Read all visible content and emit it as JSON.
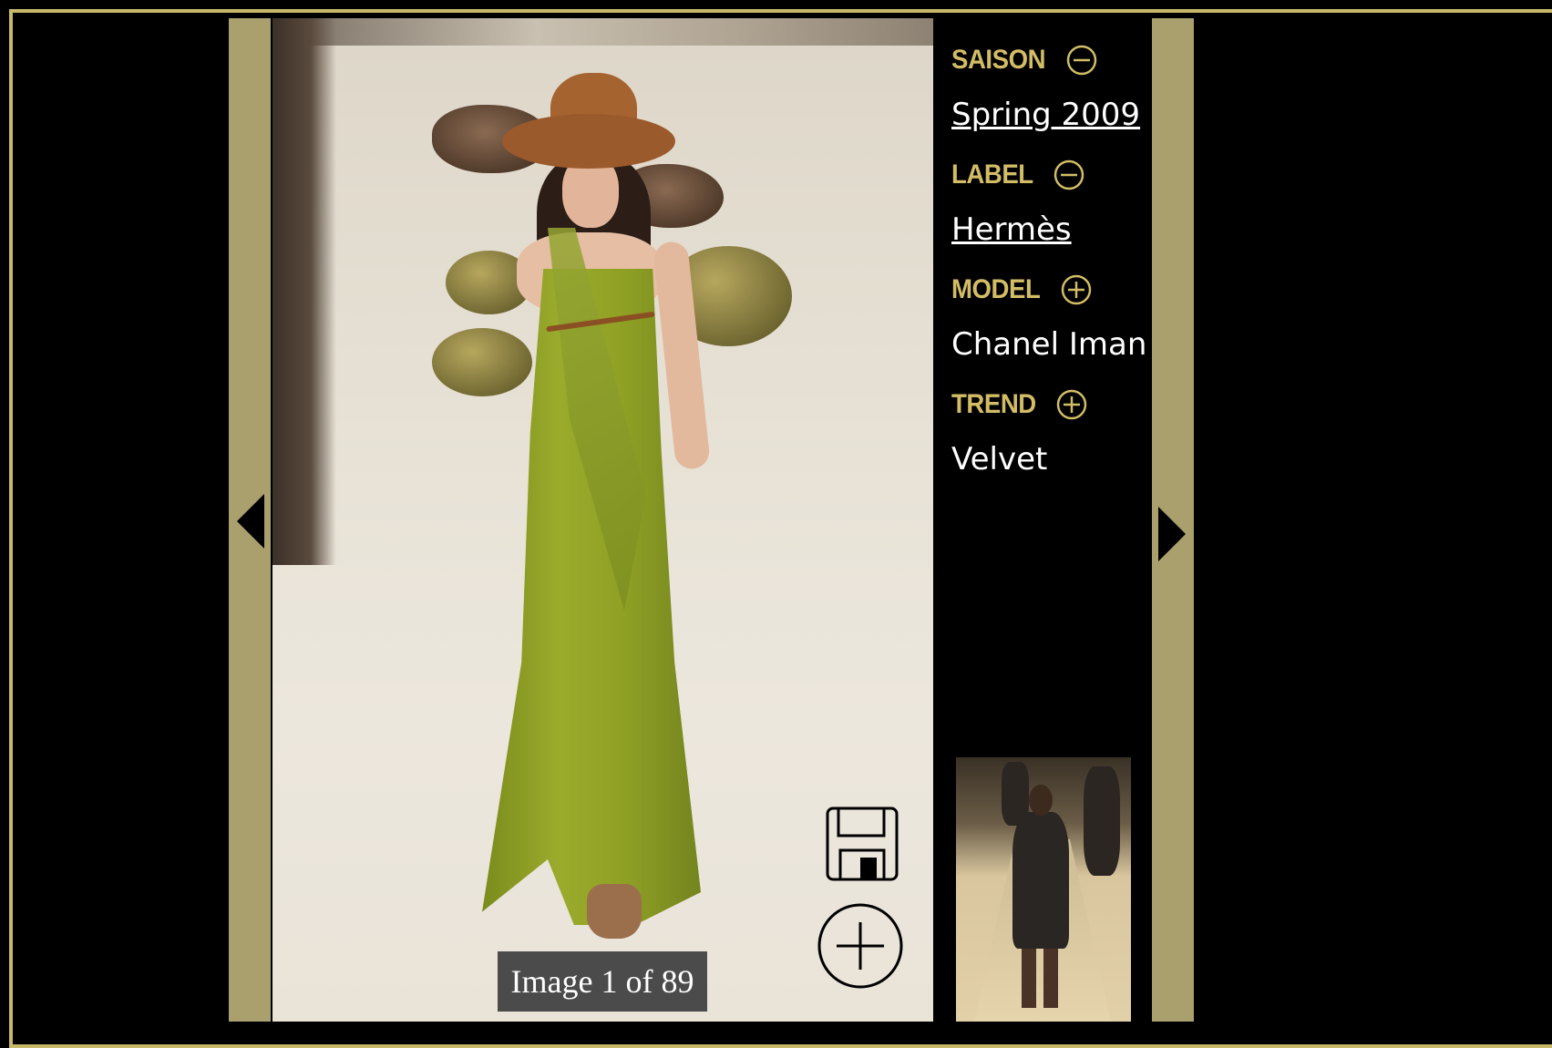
{
  "navigation": {
    "prev_label": "previous image",
    "next_label": "next image"
  },
  "image_viewer": {
    "counter_text": "Image 1 of 89"
  },
  "metadata": {
    "season": {
      "heading": "SAISON",
      "value": "Spring 2009",
      "toggle": "collapse"
    },
    "label": {
      "heading": "LABEL",
      "value": "Hermès",
      "toggle": "collapse"
    },
    "model": {
      "heading": "MODEL",
      "value": "Chanel Iman",
      "toggle": "expand"
    },
    "trend": {
      "heading": "TREND",
      "value": "Velvet",
      "toggle": "expand"
    }
  },
  "colors": {
    "background": "#000000",
    "frame": "#c8b86a",
    "side_bar": "#a9a06e",
    "heading": "#d2bd66",
    "value_text": "#ffffff",
    "counter_bg": "#4b4b4b"
  }
}
